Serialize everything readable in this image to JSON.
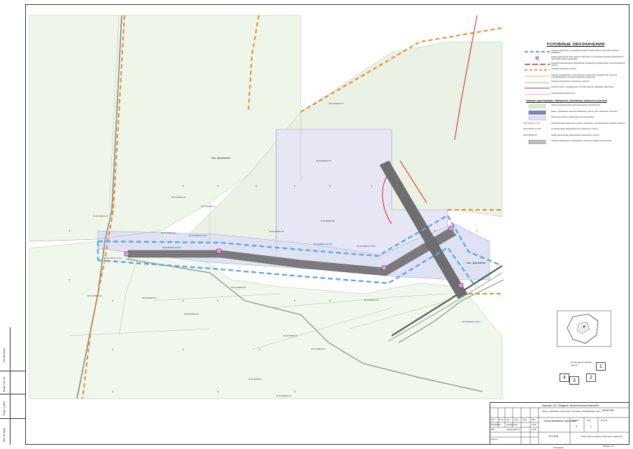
{
  "map": {
    "place_label": "пос. Дорожное",
    "place_label_2": "пос. Дорожное",
    "parcels": [
      {
        "id": "39:03:060001:13"
      },
      {
        "id": "39:03:060001:41"
      },
      {
        "id": "39:03:060001:11"
      },
      {
        "id": "39:03:060001:45"
      },
      {
        "id": "39:03:060001:10"
      },
      {
        "id": "39:03:060001:36"
      },
      {
        "id": "39:03:060001:30"
      },
      {
        "id": "39:03:060001:28"
      },
      {
        "id": "39:03:060001:42"
      },
      {
        "id": "39:03:060001:22"
      },
      {
        "id": "39:03:060001:15"
      },
      {
        "id": "39:03:060001:14"
      },
      {
        "id": "39:03:060001:3"
      },
      {
        "id": "39:03:060001:4"
      },
      {
        "id": "39:03:060001:40"
      },
      {
        "id": "39:03:060001:39"
      },
      {
        "id": "39:03:060001:38"
      }
    ],
    "blue_labels": [
      "39:03:060001:10:ЗУ1",
      "39:03:060001:10:ЗУ2",
      "39:03:060001:10:ЗУ3",
      "39:03:060001:10:ЗУ4",
      "39:03:060001:15:ЗУ1"
    ],
    "red_label": "39:03:060001:10:ЗУ1"
  },
  "legend": {
    "title": "УСЛОВНЫЕ ОБОЗНАЧЕНИЯ",
    "rows": [
      {
        "text": "Границы территории, в отношении которой осуществляется подготовка проекта межевания",
        "sym": "blue-dash"
      },
      {
        "text": "Номер характерной точки границы территории, в отношении которой осуществляется подготовка проекта межевания",
        "sym": "point"
      },
      {
        "text": "Границы муниципального образования «Гурьевский городской округ» Калининградской области",
        "sym": "red-dash"
      },
      {
        "text": "Границы населённых пунктов",
        "sym": "orange-dash"
      },
      {
        "text": "Границы планируемых и существующих элементов планировочной структуры, устанавливаемые проектом планировки территории",
        "sym": "orange-line"
      },
      {
        "text": "Границы существующих земельных участков",
        "sym": "grey-line"
      },
      {
        "text": "Красные линии, утверждённые в составе проекта планировки территории",
        "sym": "red-line"
      },
      {
        "text": "Граница водоохранной зоны",
        "sym": "pink-line"
      }
    ],
    "subtitle": "Границы существующих, образуемых, изменяемых земельных участков",
    "rows2": [
      {
        "text": "Земли государственной неразграниченной собственности",
        "sym": "green-fill"
      },
      {
        "text": "Земли, подлежащие изъятию (земельные участки, части земельных участков)",
        "sym": "darkblue-fill"
      },
      {
        "text": "Земельные участки, образуемые или изменяемые",
        "sym": "lilac-fill"
      },
      {
        "text": "Условный номер земельного участка, образуемого для размещения линейного объекта",
        "code": "39:03:060001:10:ЗУ1"
      },
      {
        "text": "Условный номер образуемой части земельного участка",
        "code": "39:03:060001:10:ЧЗУ1"
      },
      {
        "text": "Кадастровый номер существующего земельного участка",
        "code": "39:03:060001:10"
      },
      {
        "text": "Границы образуемого и изменяемого участка на период строительства",
        "sym": "grey-fill"
      }
    ]
  },
  "stamp": {
    "customer": "Заказчик: АО \"Западная Энергетическая Компания\"",
    "project_code": "0544-ПМ",
    "title": "Проект межевания территории. Основная (утверждаемая) часть",
    "sheet_title": "Чертёж межевания территории",
    "scale": "М 1:5000",
    "stage": "Стадия",
    "sheet": "Лист",
    "sheets": "Листов",
    "stage_val": "П",
    "sheet_val": "1",
    "org": "ООО \"Центр землеустройства и кадастра\"",
    "copied": "Копировал",
    "format": "Формат A1",
    "rows": [
      "Изм.",
      "Кол.уч.",
      "Лист",
      "№док.",
      "Подп.",
      "Дата"
    ],
    "people": [
      {
        "role": "Разработал",
        "name": "Кирьяков Д.С."
      },
      {
        "role": "ГИП",
        "name": "Чернаухова Т.А."
      },
      {
        "role": "Н.контр.",
        "name": ""
      }
    ],
    "dates": [
      "12.18",
      "12.18"
    ],
    "norm_label": "Взам. инв. №"
  },
  "inset": {
    "label": "Схема расположения листов",
    "sheets": [
      "1",
      "2",
      "3",
      "4"
    ]
  },
  "side": {
    "labels": [
      "Согласовано",
      "Взам. инв. №",
      "Подп. и дата",
      "Инв. № подл."
    ]
  }
}
